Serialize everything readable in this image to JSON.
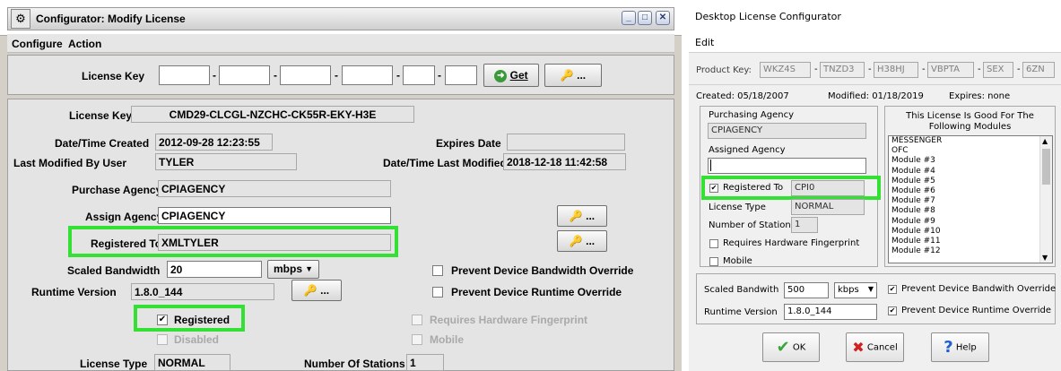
{
  "left": {
    "title": "Configurator: Modify License",
    "menu": [
      "Configure",
      "Action"
    ],
    "license_key_entry": {
      "label": "License Key",
      "segments": [
        "",
        "",
        "",
        "",
        "",
        ""
      ],
      "get_label": "Get",
      "extra_label": "..."
    },
    "form": {
      "license_key_label": "License Key",
      "license_key_value": "CMD29-CLCGL-NZCHC-CK55R-EKY-H3E",
      "created_label": "Date/Time Created",
      "created_value": "2012-09-28 12:23:55",
      "expires_label": "Expires Date",
      "expires_value": "",
      "modified_by_label": "Last Modified By User",
      "modified_by_value": "TYLER",
      "modified_label": "Date/Time Last Modified",
      "modified_value": "2018-12-18 11:42:58",
      "purchase_label": "Purchase Agency",
      "purchase_value": "CPIAGENCY",
      "assign_label": "Assign Agency",
      "assign_value": "CPIAGENCY",
      "registered_to_label": "Registered To",
      "registered_to_value": "XMLTYLER",
      "bandwidth_label": "Scaled Bandwidth",
      "bandwidth_value": "20",
      "bandwidth_unit": "mbps",
      "runtime_label": "Runtime Version",
      "runtime_value": "1.8.0_144",
      "btn_dots": "...",
      "prevent_bw_label": "Prevent Device Bandwidth Override",
      "prevent_rt_label": "Prevent Device Runtime Override",
      "registered_label": "Registered",
      "disabled_label": "Disabled",
      "req_hw_label": "Requires Hardware Fingerprint",
      "mobile_label": "Mobile",
      "license_type_label": "License Type",
      "license_type_value": "NORMAL",
      "stations_label": "Number Of Stations",
      "stations_value": "1"
    },
    "highlight_color": "#33e033"
  },
  "right": {
    "title": "Desktop License Configurator",
    "menu": [
      "Edit"
    ],
    "product_key_label": "Product Key:",
    "product_key_segments": [
      "WKZ4S",
      "TNZD3",
      "H38HJ",
      "VBPTA",
      "SEX",
      "6ZN"
    ],
    "created": "Created: 05/18/2007",
    "modified": "Modified: 01/18/2019",
    "expires": "Expires: none",
    "purchasing_label": "Purchasing Agency",
    "purchasing_value": "CPIAGENCY",
    "assigned_label": "Assigned Agency",
    "assigned_value": "",
    "registered_to_label": "Registered To",
    "registered_to_value": "CPI0",
    "license_type_label": "License Type",
    "license_type_value": "NORMAL",
    "stations_label": "Number of Stations",
    "stations_value": "1",
    "requires_hw_label": "Requires Hardware Fingerprint",
    "mobile_label": "Mobile",
    "modules_heading": "This License Is Good For The Following Modules",
    "modules": [
      "MESSENGER",
      "OFC",
      "Module #3",
      "Module #4",
      "Module #5",
      "Module #6",
      "Module #7",
      "Module #8",
      "Module #9",
      "Module #10",
      "Module #11",
      "Module #12"
    ],
    "bandwidth_label": "Scaled Bandwith",
    "bandwidth_value": "500",
    "bandwidth_unit": "kbps",
    "prevent_bw_label": "Prevent Device Bandwith Override",
    "runtime_label": "Runtime Version",
    "runtime_value": "1.8.0_144",
    "prevent_rt_label": "Prevent Device Runtime Override",
    "ok_label": "OK",
    "cancel_label": "Cancel",
    "help_label": "Help"
  }
}
